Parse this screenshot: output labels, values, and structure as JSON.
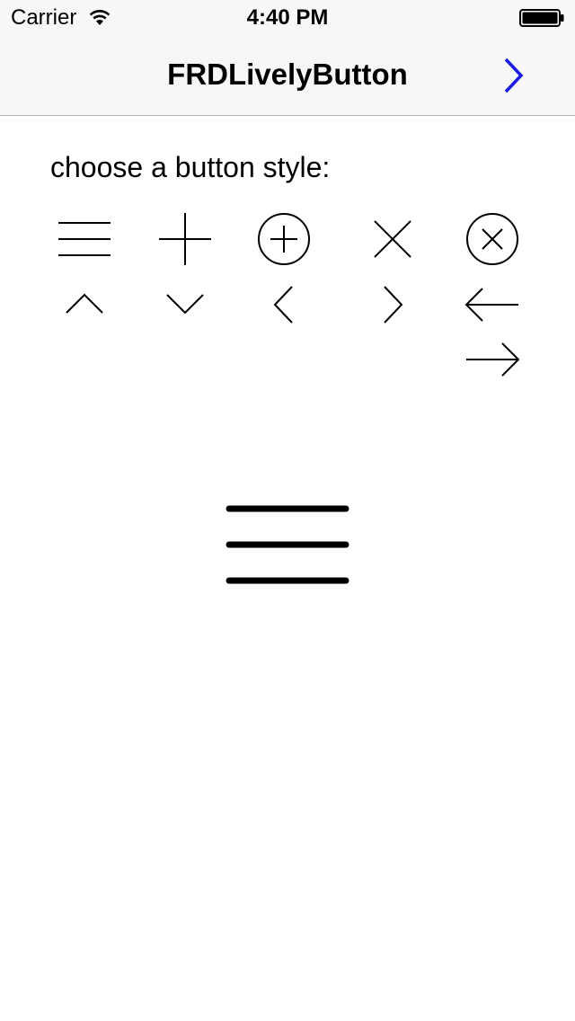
{
  "status_bar": {
    "carrier": "Carrier",
    "time": "4:40 PM"
  },
  "nav_bar": {
    "title": "FRDLivelyButton",
    "next_icon": "chevron-right-icon",
    "accent_color": "#1a1ae6"
  },
  "content": {
    "prompt": "choose a button style:",
    "styles": [
      {
        "name": "hamburger-icon"
      },
      {
        "name": "plus-icon"
      },
      {
        "name": "circle-plus-icon"
      },
      {
        "name": "close-icon"
      },
      {
        "name": "circle-close-icon"
      },
      {
        "name": "caret-up-icon"
      },
      {
        "name": "caret-down-icon"
      },
      {
        "name": "caret-left-icon"
      },
      {
        "name": "caret-right-icon"
      },
      {
        "name": "arrow-left-icon"
      },
      {
        "name": "arrow-right-icon"
      }
    ],
    "preview_icon": "hamburger-icon"
  }
}
